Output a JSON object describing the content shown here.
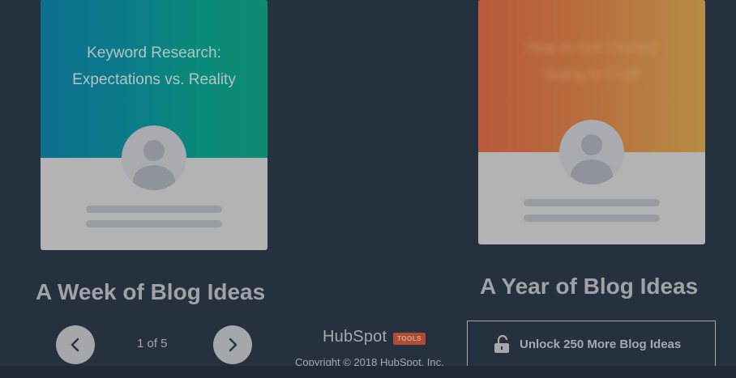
{
  "cards": {
    "week": {
      "title": "Keyword Research:\nExpectations vs. Reality",
      "heading": "A Week of Blog Ideas"
    },
    "year": {
      "blurred_title": "How to Get Started\nGoing to Draft",
      "heading": "A Year of Blog Ideas"
    }
  },
  "pagination": {
    "indicator": "1 of 5",
    "prev_icon": "chevron-left-icon",
    "next_icon": "chevron-right-icon"
  },
  "branding": {
    "logo_text": "HubSpot",
    "badge": "TOOLS",
    "copyright": "Copyright © 2018 HubSpot, Inc."
  },
  "unlock": {
    "label": "Unlock 250 More Blog Ideas",
    "icon": "unlock-icon"
  },
  "colors": {
    "background": "#25313f",
    "week_gradient_start": "#0d6f8f",
    "week_gradient_end": "#0d8b72",
    "year_gradient_start": "#b8593b",
    "year_gradient_end": "#b78d44",
    "badge": "#b04c35"
  }
}
